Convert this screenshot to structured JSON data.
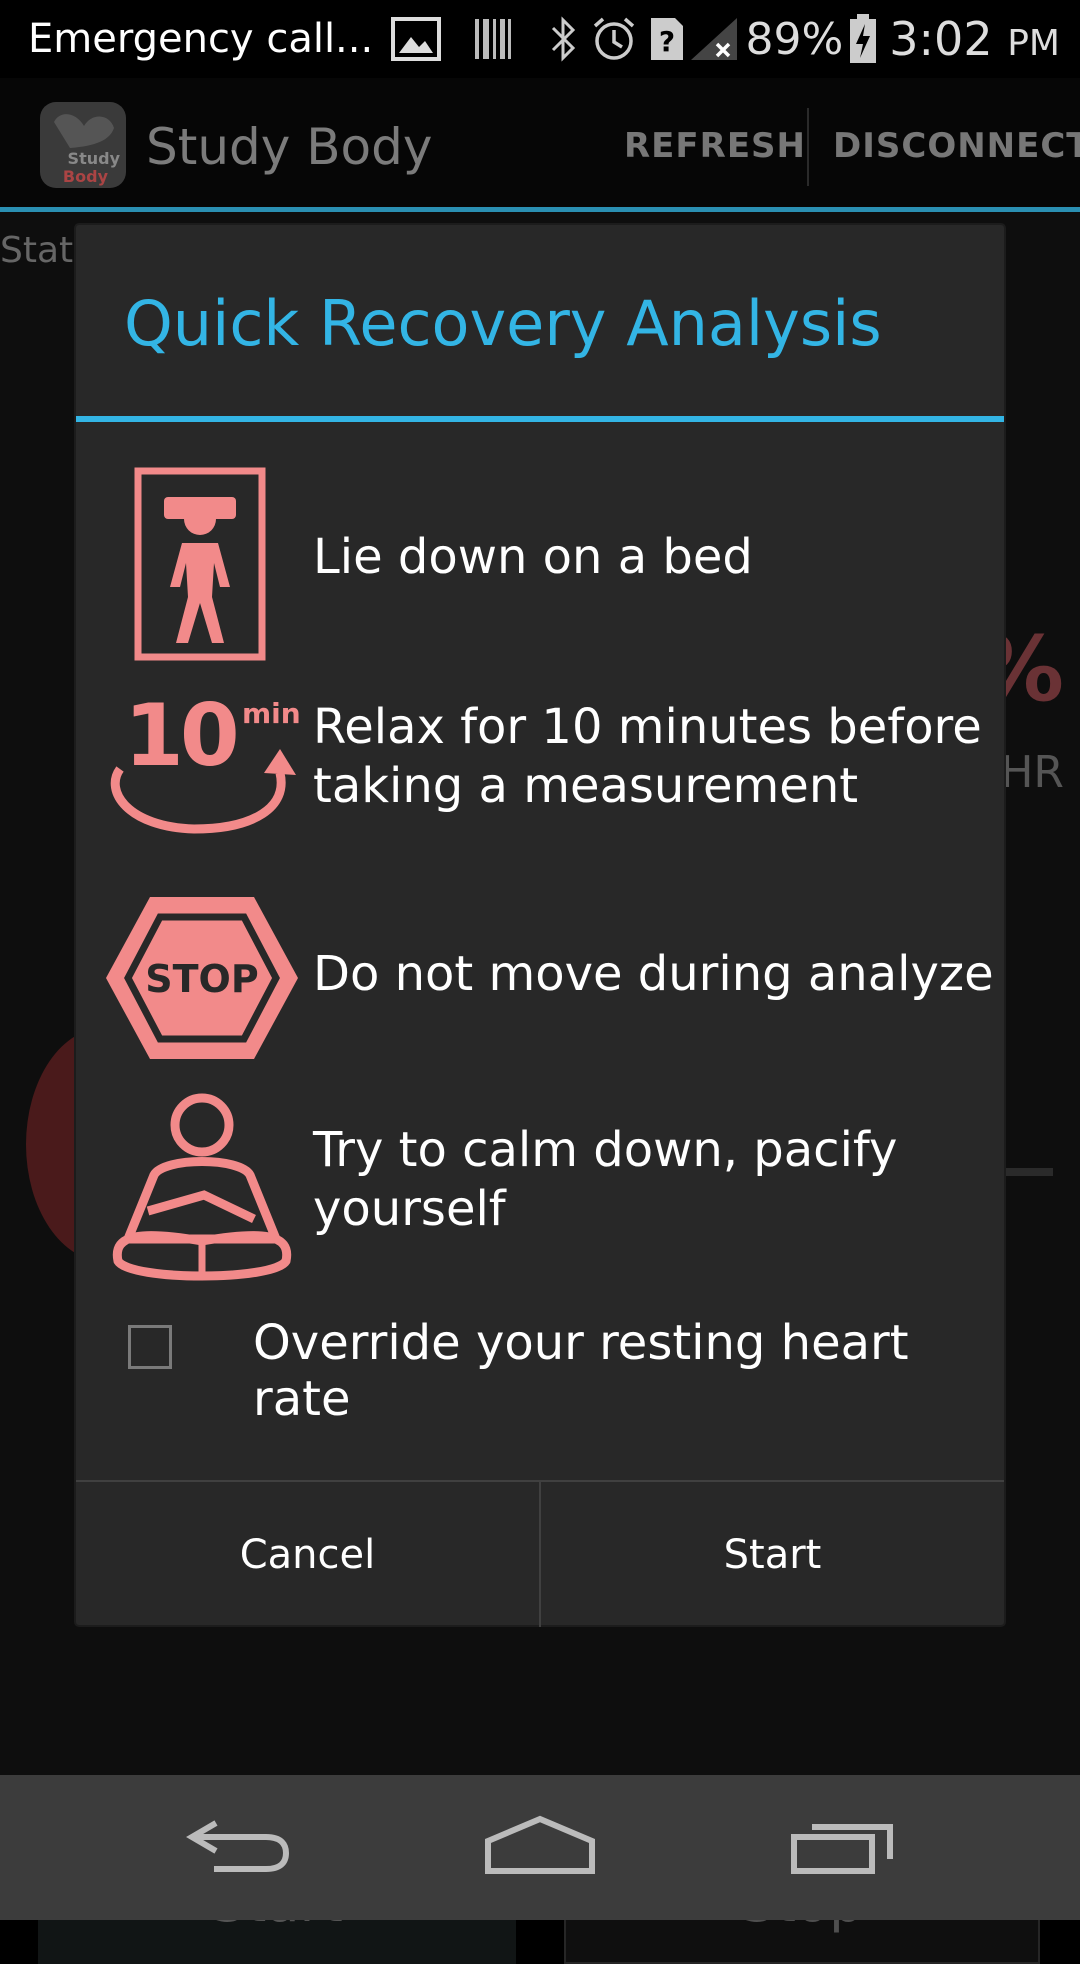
{
  "status_bar": {
    "notification_text": "Emergency call...",
    "battery_percent": "89%",
    "time": "3:02",
    "ampm": "PM",
    "icons": [
      "image-icon",
      "barcode-icon",
      "bluetooth-icon",
      "alarm-icon",
      "unknown-sim-icon",
      "no-signal-icon",
      "battery-charging-icon"
    ]
  },
  "action_bar": {
    "app_name": "Study Body",
    "logo_text_1": "Study",
    "logo_text_2": "Body",
    "refresh_label": "REFRESH",
    "disconnect_label": "DISCONNECT"
  },
  "background": {
    "state_label": "State",
    "percent_fragment": "%",
    "hr_fragment": "HR",
    "start_label": "Start",
    "stop_label": "Stop"
  },
  "dialog": {
    "title": "Quick Recovery Analysis",
    "steps": [
      {
        "icon": "bed-icon",
        "text": "Lie down on a bed"
      },
      {
        "icon": "ten-minutes-timer-icon",
        "text": "Relax for 10 minutes before taking a measurement",
        "icon_number": "10",
        "icon_unit": "min"
      },
      {
        "icon": "stop-sign-icon",
        "text": "Do not move during analyze",
        "icon_label": "STOP"
      },
      {
        "icon": "meditation-icon",
        "text": "Try to calm down, pacify yourself"
      }
    ],
    "override_checkbox": {
      "label": "Override your resting heart rate",
      "checked": false
    },
    "cancel_label": "Cancel",
    "start_label": "Start"
  },
  "colors": {
    "accent": "#33b5e5",
    "icon_pink": "#f28a8a",
    "dialog_bg": "#282828"
  }
}
